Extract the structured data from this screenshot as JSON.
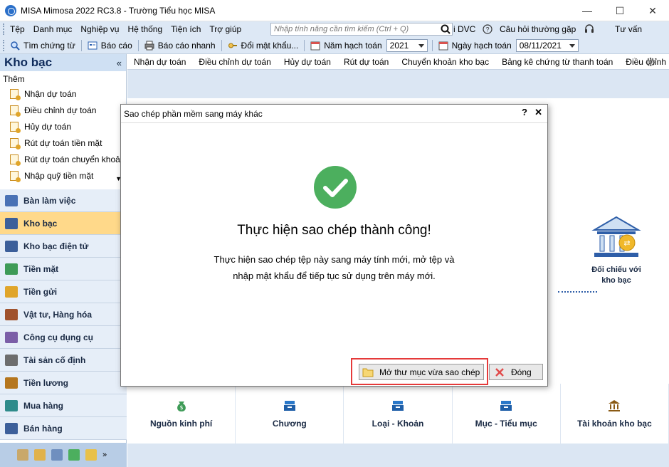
{
  "window": {
    "title": "MISA Mimosa 2022 RC3.8 - Trường Tiểu học MISA",
    "minimize": "—",
    "maximize": "☐",
    "close": "✕"
  },
  "menu": {
    "items": [
      "Tệp",
      "Danh mục",
      "Nghiệp vụ",
      "Hệ thống",
      "Tiện ích",
      "Trợ giúp"
    ],
    "search_placeholder": "Nhập tính năng cần tìm kiếm (Ctrl + Q)",
    "dvc": "i DVC",
    "faq": "Câu hỏi thường gặp",
    "consult": "Tư vấn"
  },
  "toolbar": {
    "find_voucher": "Tìm chứng từ",
    "report": "Báo cáo",
    "quick_report": "Báo cáo nhanh",
    "change_password": "Đổi mật khẩu...",
    "fiscal_year_label": "Năm hạch toán",
    "fiscal_year_value": "2021",
    "posting_date_label": "Ngày hạch toán",
    "posting_date_value": "08/11/2021"
  },
  "sidebar": {
    "title": "Kho bạc",
    "add_label": "Thêm",
    "links": [
      "Nhận dự toán",
      "Điều chỉnh dự toán",
      "Hủy dự toán",
      "Rút dự toán tiền mặt",
      "Rút dự toán chuyển khoản",
      "Nhập quỹ tiền mặt"
    ],
    "nav": [
      {
        "label": "Bàn làm việc",
        "color": "#4a72b5"
      },
      {
        "label": "Kho bạc",
        "color": "#3c5f9a"
      },
      {
        "label": "Kho bạc điện tử",
        "color": "#3c5f9a"
      },
      {
        "label": "Tiền mặt",
        "color": "#3e9b57"
      },
      {
        "label": "Tiền gửi",
        "color": "#e0a52a"
      },
      {
        "label": "Vật tư, Hàng hóa",
        "color": "#a0522d"
      },
      {
        "label": "Công cụ dụng cụ",
        "color": "#7b5ea7"
      },
      {
        "label": "Tài sản cố định",
        "color": "#6d6d6d"
      },
      {
        "label": "Tiền lương",
        "color": "#b5761e"
      },
      {
        "label": "Mua hàng",
        "color": "#2e8b8b"
      },
      {
        "label": "Bán hàng",
        "color": "#3c5f9a"
      }
    ]
  },
  "subtabs": [
    "Nhận dự toán",
    "Điều chỉnh dự toán",
    "Hủy dự toán",
    "Rút dự toán",
    "Chuyển khoản kho bạc",
    "Bảng kê chứng từ thanh toán",
    "Điều chỉnh kinh"
  ],
  "diagram": {
    "bank_label": "Đối chiếu với kho bạc"
  },
  "cards": [
    {
      "label": "Nguồn kinh phí",
      "icon": "money-bag-icon"
    },
    {
      "label": "Chương",
      "icon": "tray-icon"
    },
    {
      "label": "Loại - Khoản",
      "icon": "tray-icon"
    },
    {
      "label": "Mục - Tiểu mục",
      "icon": "tray-icon"
    },
    {
      "label": "Tài khoản kho bạc",
      "icon": "bank-icon"
    }
  ],
  "dialog": {
    "title": "Sao chép phần mềm sang máy khác",
    "help": "?",
    "close": "✕",
    "heading": "Thực hiện sao chép thành công!",
    "body_line1": "Thực hiện sao chép tệp này sang máy tính mới, mở tệp và",
    "body_line2": "nhập mật khẩu để tiếp tục sử dụng trên máy mới.",
    "open_folder_button": "Mở thư mục vừa sao chép",
    "close_button": "Đóng",
    "success_color": "#4caf5e",
    "highlight_color": "#e53a3a"
  }
}
